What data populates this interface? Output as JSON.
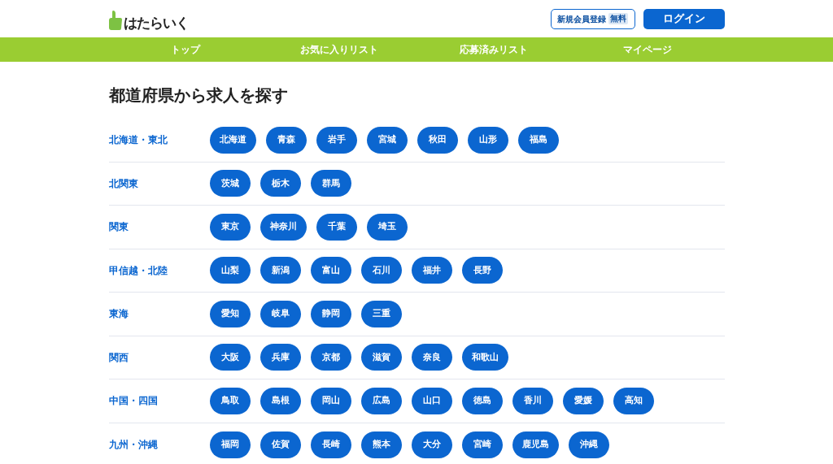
{
  "header": {
    "logo_text": "はたらいく",
    "register_button": {
      "label": "新規会員登録",
      "badge": "無料"
    },
    "login_button": "ログイン"
  },
  "nav": [
    "トップ",
    "お気に入りリスト",
    "応募済みリスト",
    "マイページ"
  ],
  "title": "都道府県から求人を探す",
  "regions": [
    {
      "name": "北海道・東北",
      "prefectures": [
        "北海道",
        "青森",
        "岩手",
        "宮城",
        "秋田",
        "山形",
        "福島"
      ]
    },
    {
      "name": "北関東",
      "prefectures": [
        "茨城",
        "栃木",
        "群馬"
      ]
    },
    {
      "name": "関東",
      "prefectures": [
        "東京",
        "神奈川",
        "千葉",
        "埼玉"
      ]
    },
    {
      "name": "甲信越・北陸",
      "prefectures": [
        "山梨",
        "新潟",
        "富山",
        "石川",
        "福井",
        "長野"
      ]
    },
    {
      "name": "東海",
      "prefectures": [
        "愛知",
        "岐阜",
        "静岡",
        "三重"
      ]
    },
    {
      "name": "関西",
      "prefectures": [
        "大阪",
        "兵庫",
        "京都",
        "滋賀",
        "奈良",
        "和歌山"
      ]
    },
    {
      "name": "中国・四国",
      "prefectures": [
        "鳥取",
        "島根",
        "岡山",
        "広島",
        "山口",
        "徳島",
        "香川",
        "愛媛",
        "高知"
      ]
    },
    {
      "name": "九州・沖縄",
      "prefectures": [
        "福岡",
        "佐賀",
        "長崎",
        "熊本",
        "大分",
        "宮崎",
        "鹿児島",
        "沖縄"
      ]
    }
  ]
}
